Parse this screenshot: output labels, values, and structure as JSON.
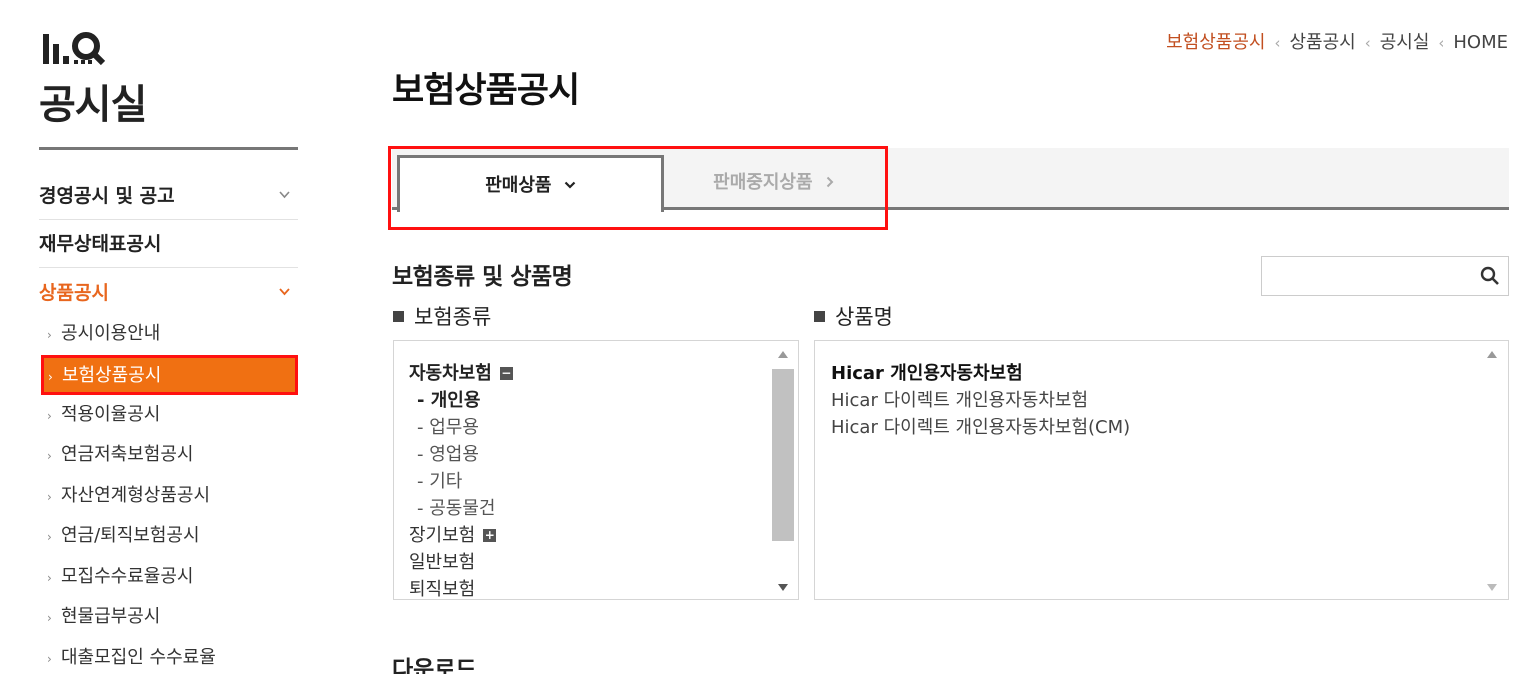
{
  "sidebar": {
    "title": "공시실",
    "menu": [
      {
        "label": "경영공시 및 공고"
      },
      {
        "label": "재무상태표공시"
      },
      {
        "label": "상품공시"
      }
    ],
    "sub_items": [
      {
        "label": "공시이용안내"
      },
      {
        "label": "보험상품공시"
      },
      {
        "label": "적용이율공시"
      },
      {
        "label": "연금저축보험공시"
      },
      {
        "label": "자산연계형상품공시"
      },
      {
        "label": "연금/퇴직보험공시"
      },
      {
        "label": "모집수수료율공시"
      },
      {
        "label": "현물급부공시"
      },
      {
        "label": "대출모집인 수수료율"
      }
    ],
    "arrow": "›",
    "active_color": "#f07012"
  },
  "breadcrumb": {
    "items": [
      "보험상품공시",
      "상품공시",
      "공시실",
      "HOME"
    ],
    "separator": "‹"
  },
  "page_title": "보험상품공시",
  "tabs": [
    {
      "label": "판매상품",
      "arrow": "⌄"
    },
    {
      "label": "판매중지상품",
      "arrow": "›"
    }
  ],
  "section_title": "보험종류 및 상품명",
  "search": {
    "value": "",
    "placeholder": ""
  },
  "type_column": {
    "header": "보험종류",
    "rows": [
      {
        "label": "자동차보험",
        "toggle": "−"
      },
      {
        "label": "- 개인용"
      },
      {
        "label": "- 업무용"
      },
      {
        "label": "- 영업용"
      },
      {
        "label": "- 기타"
      },
      {
        "label": "- 공동물건"
      },
      {
        "label": "장기보험",
        "toggle": "+"
      },
      {
        "label": "일반보험"
      },
      {
        "label": "퇴직보험"
      }
    ]
  },
  "product_column": {
    "header": "상품명",
    "rows": [
      {
        "label": "Hicar 개인용자동차보험"
      },
      {
        "label": "Hicar 다이렉트 개인용자동차보험"
      },
      {
        "label": "Hicar 다이렉트 개인용자동차보험(CM)"
      }
    ]
  },
  "download_title": "다운로드",
  "colors": {
    "accent": "#e8661e",
    "highlight_border": "#ff1010",
    "breadcrumb_current": "#c24f20"
  }
}
